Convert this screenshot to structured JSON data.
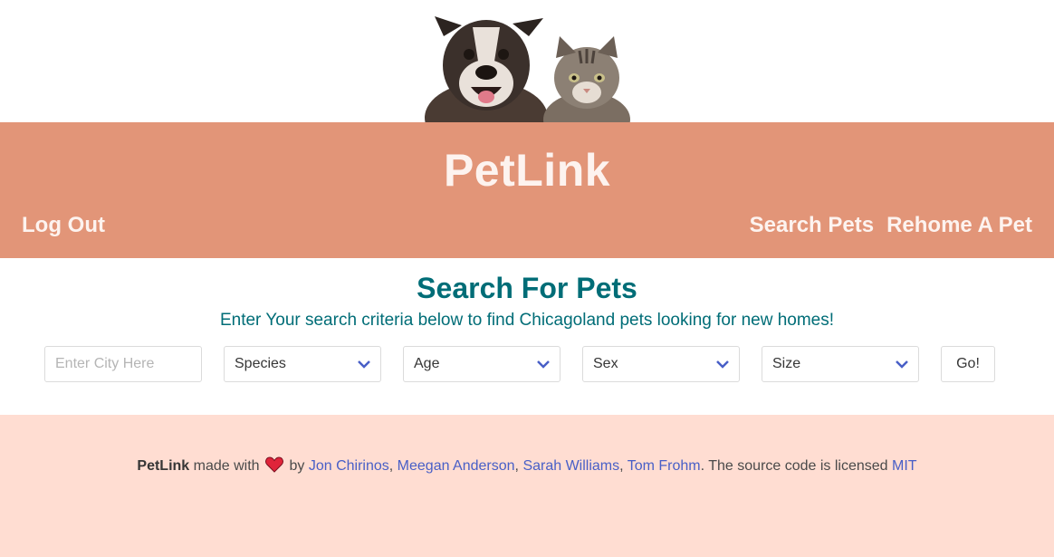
{
  "header": {
    "brand": "PetLink",
    "nav_left": "Log Out",
    "nav_right": [
      "Search Pets",
      "Rehome A Pet"
    ],
    "hero_image": "dog-and-cat-illustration"
  },
  "search": {
    "title": "Search For Pets",
    "subtitle": "Enter Your search criteria below to find Chicagoland pets looking for new homes!",
    "city_placeholder": "Enter City Here",
    "species": "Species",
    "age": "Age",
    "sex": "Sex",
    "size": "Size",
    "go": "Go!"
  },
  "footer": {
    "brand": "PetLink",
    "made_with": "made with",
    "by": "by",
    "authors": [
      "Jon Chirinos",
      "Meegan Anderson",
      "Sarah Williams",
      "Tom Frohm"
    ],
    "license_text": "The source code is licensed",
    "license": "MIT"
  },
  "colors": {
    "banner": "#e29578",
    "heading": "#006d77",
    "footer_bg": "#ffddd2",
    "link": "#485fc7"
  }
}
